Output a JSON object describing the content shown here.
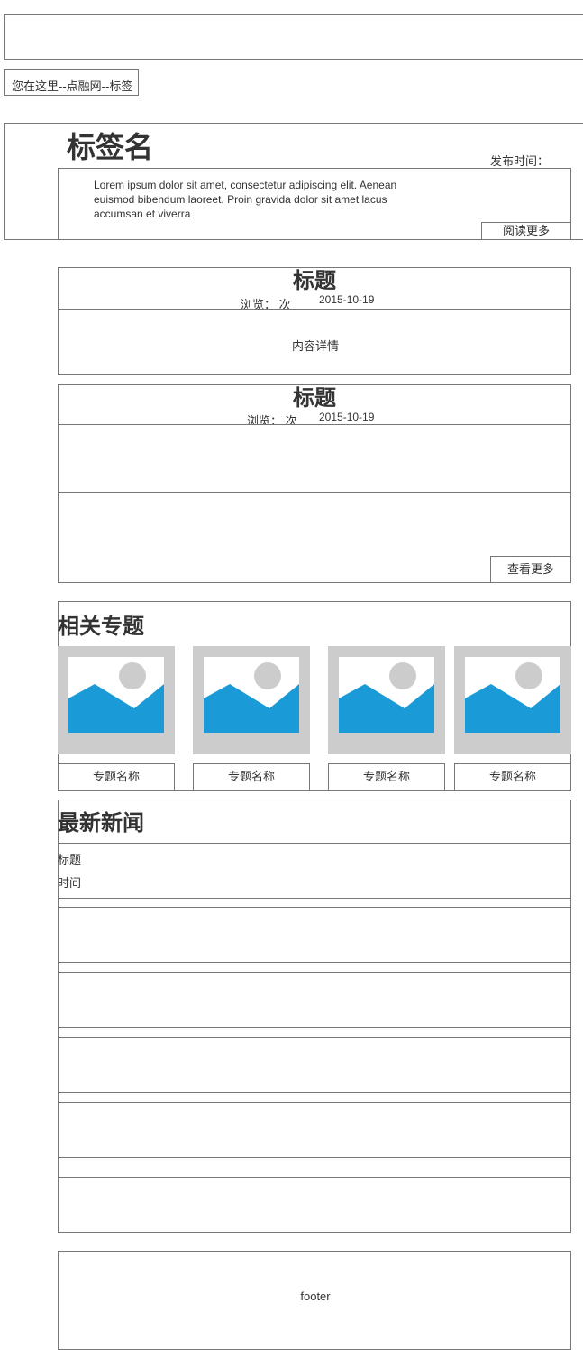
{
  "breadcrumb": {
    "text": "您在这里--点融网--标签"
  },
  "tag_header": {
    "name": "标签名",
    "publish_label": "发布时间：",
    "summary": "Lorem ipsum dolor sit amet, consectetur adipiscing elit. Aenean euismod bibendum laoreet. Proin gravida dolor sit amet lacus accumsan et viverra",
    "read_more": "阅读更多"
  },
  "articles": [
    {
      "title": "标题",
      "views": "浏览： 次",
      "date": "2015-10-19",
      "content": "内容详情"
    },
    {
      "title": "标题",
      "views": "浏览： 次",
      "date": "2015-10-19",
      "content": ""
    }
  ],
  "view_more": "查看更多",
  "related_topics": {
    "heading": "相关专题",
    "items": [
      {
        "name": "专题名称"
      },
      {
        "name": "专题名称"
      },
      {
        "name": "专题名称"
      },
      {
        "name": "专题名称"
      }
    ]
  },
  "latest_news": {
    "heading": "最新新闻",
    "first_item": {
      "title": "标题",
      "time": "时间"
    }
  },
  "footer": {
    "text": "footer"
  },
  "colors": {
    "placeholder_gray": "#cccccc",
    "placeholder_blue": "#1a9ad6",
    "border": "#777777"
  },
  "icons": {
    "topic_image": "image-placeholder-icon"
  }
}
